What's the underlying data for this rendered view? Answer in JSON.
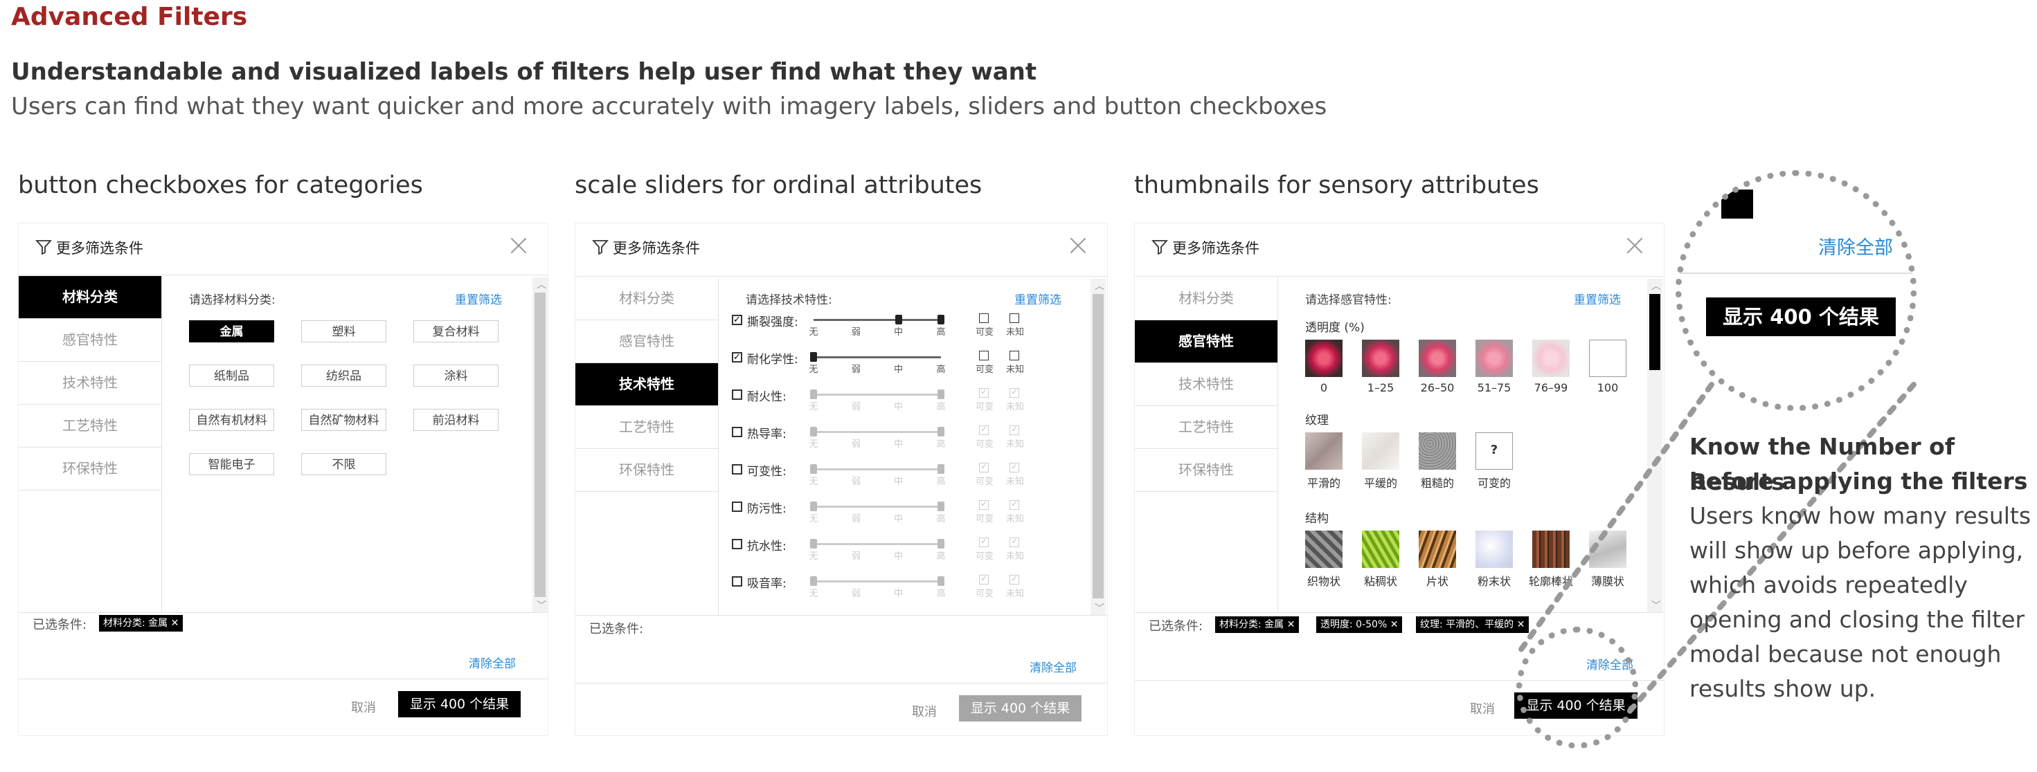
{
  "header": {
    "title": "Advanced Filters",
    "subtitle": "Understandable and visualized labels of filters help user find what they want",
    "description": "Users can find what they want quicker and more accurately with imagery labels, sliders and button checkboxes"
  },
  "captions": {
    "panel1": "button checkboxes for categories",
    "panel2": "scale sliders for ordinal attributes",
    "panel3": "thumbnails for sensory attributes"
  },
  "modal": {
    "title": "更多筛选条件",
    "reset": "重置筛选",
    "selected_label": "已选条件:",
    "clear_all": "清除全部",
    "cancel": "取消",
    "show_results": "显示 400 个结果",
    "sidebar": [
      "材料分类",
      "感官特性",
      "技术特性",
      "工艺特性",
      "环保特性"
    ]
  },
  "panel1": {
    "prompt": "请选择材料分类:",
    "options": [
      "金属",
      "塑料",
      "复合材料",
      "纸制品",
      "纺织品",
      "涂料",
      "自然有机材料",
      "自然矿物材料",
      "前沿材料",
      "智能电子",
      "不限"
    ],
    "selected_option": "金属",
    "tags": [
      "材料分类: 金属 ✕"
    ]
  },
  "panel2": {
    "prompt": "请选择技术特性:",
    "scale_labels": [
      "无",
      "弱",
      "中",
      "高"
    ],
    "extra_labels": [
      "可变",
      "未知"
    ],
    "rows": [
      {
        "label": "撕裂强度:",
        "checked": true,
        "level": "高"
      },
      {
        "label": "耐化学性:",
        "checked": true,
        "level": "无"
      },
      {
        "label": "耐火性:",
        "checked": false
      },
      {
        "label": "热导率:",
        "checked": false
      },
      {
        "label": "可变性:",
        "checked": false
      },
      {
        "label": "防污性:",
        "checked": false
      },
      {
        "label": "抗水性:",
        "checked": false
      },
      {
        "label": "吸音率:",
        "checked": false
      }
    ]
  },
  "panel3": {
    "prompt": "请选择感官特性:",
    "transparency": {
      "title": "透明度 (%)",
      "items": [
        "0",
        "1–25",
        "26–50",
        "51–75",
        "76–99",
        "100"
      ]
    },
    "texture": {
      "title": "纹理",
      "items": [
        "平滑的",
        "平缓的",
        "粗糙的",
        "可变的"
      ],
      "unknown_glyph": "?"
    },
    "structure": {
      "title": "结构",
      "items": [
        "织物状",
        "粘稠状",
        "片状",
        "粉末状",
        "轮廓棒状",
        "薄膜状"
      ]
    },
    "tags": [
      "材料分类: 金属 ✕",
      "透明度: 0-50% ✕",
      "纹理: 平滑的、平缓的 ✕"
    ]
  },
  "zoom": {
    "clear_all": "清除全部",
    "show_results": "显示 400 个结果"
  },
  "note": {
    "title_line1": "Know the Number of Results",
    "title_line2": "before applying the filters",
    "body_lines": [
      "Users know how many results",
      "will show up before applying,",
      "which avoids repeatedly",
      "opening and closing the filter",
      "modal because not enough",
      "results show up."
    ]
  },
  "colors": {
    "title_red": "#a32523",
    "link_blue": "#2a8ad8",
    "active_black": "#000000"
  }
}
